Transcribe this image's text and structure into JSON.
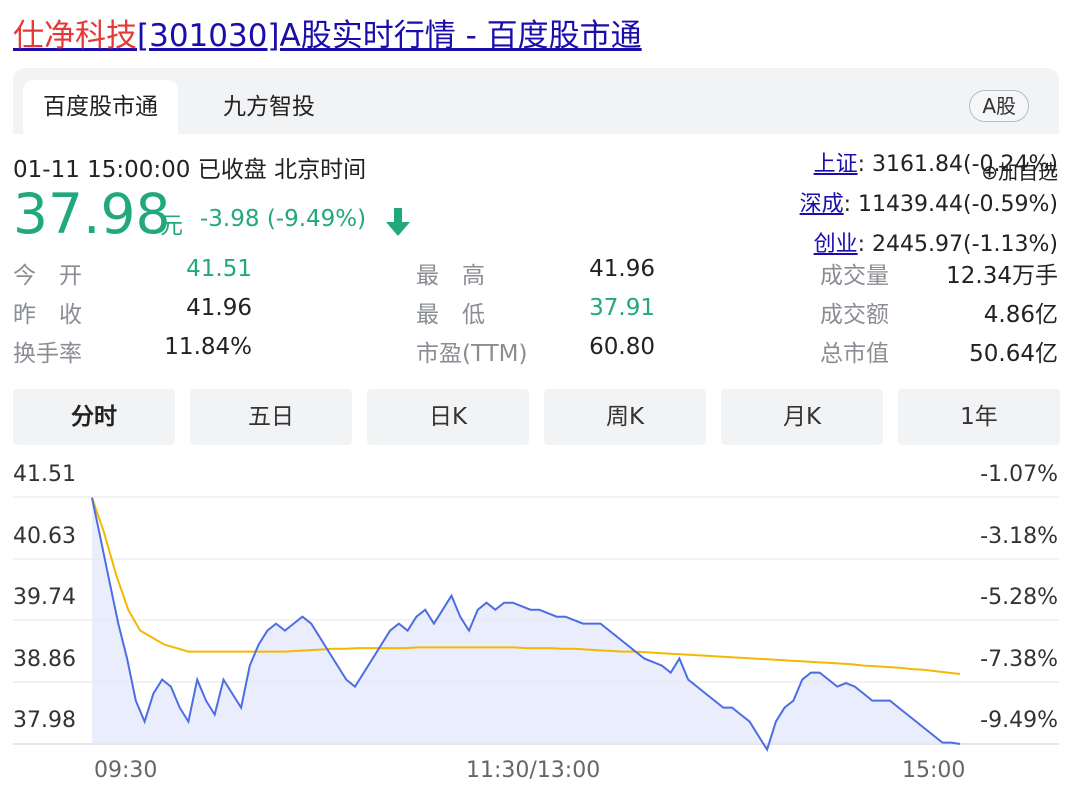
{
  "page_title": {
    "stock": "仕净科技",
    "rest": "[301030]A股实时行情 - 百度股市通"
  },
  "tabs": [
    {
      "label": "百度股市通"
    },
    {
      "label": "九方智投"
    }
  ],
  "market_badge": "A股",
  "quote_time": "01-11 15:00:00  已收盘  北京时间",
  "price": "37.98",
  "currency": "元",
  "change": "-3.98 (-9.49%)",
  "indices": [
    {
      "name": "上证",
      "value": ": 3161.84(-0.24%)"
    },
    {
      "name": "深成",
      "value": ": 11439.44(-0.59%)"
    },
    {
      "name": "创业",
      "value": ": 2445.97(-1.13%)"
    }
  ],
  "add_watchlist": "⊕加自选",
  "stats": [
    {
      "label": "今　开",
      "value": "41.51"
    },
    {
      "label": "昨　收",
      "value": "41.96"
    },
    {
      "label": "换手率",
      "value": "11.84%"
    },
    {
      "label": "最　高",
      "value": "41.96"
    },
    {
      "label": "最　低",
      "value": "37.91"
    },
    {
      "label": "市盈(TTM)",
      "value": "60.80"
    },
    {
      "label": "成交量",
      "value": "12.34万手"
    },
    {
      "label": "成交额",
      "value": "4.86亿"
    },
    {
      "label": "总市值",
      "value": "50.64亿"
    }
  ],
  "periods": [
    "分时",
    "五日",
    "日K",
    "周K",
    "月K",
    "1年"
  ],
  "colors": {
    "up": "#e53935",
    "down": "#21a87f",
    "price_line": "#4d6de3",
    "avg_line": "#f5b800",
    "link": "#1a0dab"
  },
  "chart_data": {
    "type": "line",
    "ylim": [
      37.98,
      41.51
    ],
    "y_ticks_left": [
      "41.51",
      "40.63",
      "39.74",
      "38.86",
      "37.98"
    ],
    "y_ticks_right": [
      "-1.07%",
      "-3.18%",
      "-5.28%",
      "-7.38%",
      "-9.49%"
    ],
    "x_ticks": [
      "09:30",
      "11:30/13:00",
      "15:00"
    ],
    "grid": true,
    "series": [
      {
        "role": "price",
        "values": [
          41.5,
          40.9,
          40.3,
          39.7,
          39.2,
          38.6,
          38.3,
          38.7,
          38.9,
          38.8,
          38.5,
          38.3,
          38.9,
          38.6,
          38.4,
          38.9,
          38.7,
          38.5,
          39.1,
          39.4,
          39.6,
          39.7,
          39.6,
          39.7,
          39.8,
          39.7,
          39.5,
          39.3,
          39.1,
          38.9,
          38.8,
          39.0,
          39.2,
          39.4,
          39.6,
          39.7,
          39.6,
          39.8,
          39.9,
          39.7,
          39.9,
          40.1,
          39.8,
          39.6,
          39.9,
          40.0,
          39.9,
          40.0,
          40.0,
          39.95,
          39.9,
          39.9,
          39.85,
          39.8,
          39.8,
          39.75,
          39.7,
          39.7,
          39.7,
          39.6,
          39.5,
          39.4,
          39.3,
          39.2,
          39.15,
          39.1,
          39.0,
          39.2,
          38.9,
          38.8,
          38.7,
          38.6,
          38.5,
          38.5,
          38.4,
          38.3,
          38.1,
          37.9,
          38.3,
          38.5,
          38.6,
          38.9,
          39.0,
          39.0,
          38.9,
          38.8,
          38.85,
          38.8,
          38.7,
          38.6,
          38.6,
          38.6,
          38.5,
          38.4,
          38.3,
          38.2,
          38.1,
          38.0,
          38.0,
          37.98
        ]
      },
      {
        "role": "average",
        "values": [
          41.5,
          41.0,
          40.4,
          39.9,
          39.6,
          39.5,
          39.4,
          39.35,
          39.3,
          39.3,
          39.3,
          39.3,
          39.3,
          39.3,
          39.3,
          39.3,
          39.3,
          39.31,
          39.32,
          39.33,
          39.34,
          39.34,
          39.35,
          39.35,
          39.35,
          39.35,
          39.35,
          39.36,
          39.36,
          39.36,
          39.36,
          39.36,
          39.36,
          39.36,
          39.36,
          39.36,
          39.35,
          39.35,
          39.35,
          39.34,
          39.34,
          39.33,
          39.32,
          39.31,
          39.3,
          39.3,
          39.29,
          39.28,
          39.27,
          39.26,
          39.25,
          39.24,
          39.23,
          39.22,
          39.21,
          39.2,
          39.19,
          39.18,
          39.17,
          39.16,
          39.15,
          39.14,
          39.13,
          39.12,
          39.1,
          39.09,
          39.08,
          39.07,
          39.05,
          39.04,
          39.02,
          39.0,
          38.98
        ]
      }
    ]
  }
}
